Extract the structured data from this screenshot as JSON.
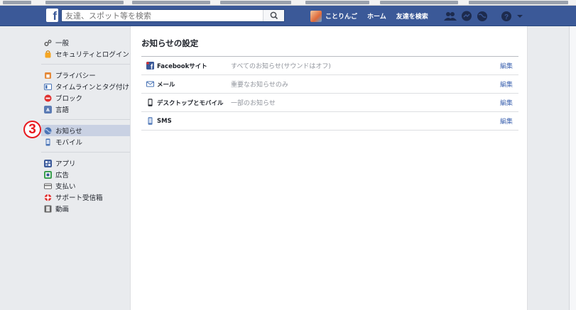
{
  "header": {
    "search_placeholder": "友達、スポット等を検索",
    "user_name": "ことりんご",
    "home": "ホーム",
    "find_friends": "友達を検索"
  },
  "sidebar": {
    "groups": [
      [
        {
          "label": "一般",
          "icon": "gear-icon",
          "color": "#555555"
        },
        {
          "label": "セキュリティとログイン",
          "icon": "shield-icon",
          "color": "#f5a623"
        }
      ],
      [
        {
          "label": "プライバシー",
          "icon": "lock-icon",
          "color": "#e48a3b"
        },
        {
          "label": "タイムラインとタグ付け",
          "icon": "timeline-icon",
          "color": "#4a74b6"
        },
        {
          "label": "ブロック",
          "icon": "block-icon",
          "color": "#e0302f"
        },
        {
          "label": "言語",
          "icon": "language-icon",
          "color": "#4a74b6"
        }
      ],
      [
        {
          "label": "お知らせ",
          "icon": "globe-icon",
          "color": "#4a74b6",
          "selected": true
        },
        {
          "label": "モバイル",
          "icon": "mobile-icon",
          "color": "#4a74b6"
        }
      ],
      [
        {
          "label": "アプリ",
          "icon": "apps-icon",
          "color": "#4a74b6"
        },
        {
          "label": "広告",
          "icon": "ads-icon",
          "color": "#3b9f4f"
        },
        {
          "label": "支払い",
          "icon": "card-icon",
          "color": "#666666"
        },
        {
          "label": "サポート受信箱",
          "icon": "lifebuoy-icon",
          "color": "#e0302f"
        },
        {
          "label": "動画",
          "icon": "film-icon",
          "color": "#666666"
        }
      ]
    ],
    "annotation": "3"
  },
  "main": {
    "title": "お知らせの設定",
    "rows": [
      {
        "label": "Facebookサイト",
        "value": "すべてのお知らせ(サウンドはオフ)",
        "edit": "編集",
        "icon": "facebook-icon"
      },
      {
        "label": "メール",
        "value": "重要なお知らせのみ",
        "edit": "編集",
        "icon": "mail-icon"
      },
      {
        "label": "デスクトップとモバイル",
        "value": "一部のお知らせ",
        "edit": "編集",
        "icon": "phone-icon"
      },
      {
        "label": "SMS",
        "value": "",
        "edit": "編集",
        "icon": "sms-icon"
      }
    ]
  },
  "colors": {
    "brand": "#3b5998",
    "link": "#4267b2",
    "selected_bg": "#c9d1e3",
    "marker": "#e8191f"
  }
}
